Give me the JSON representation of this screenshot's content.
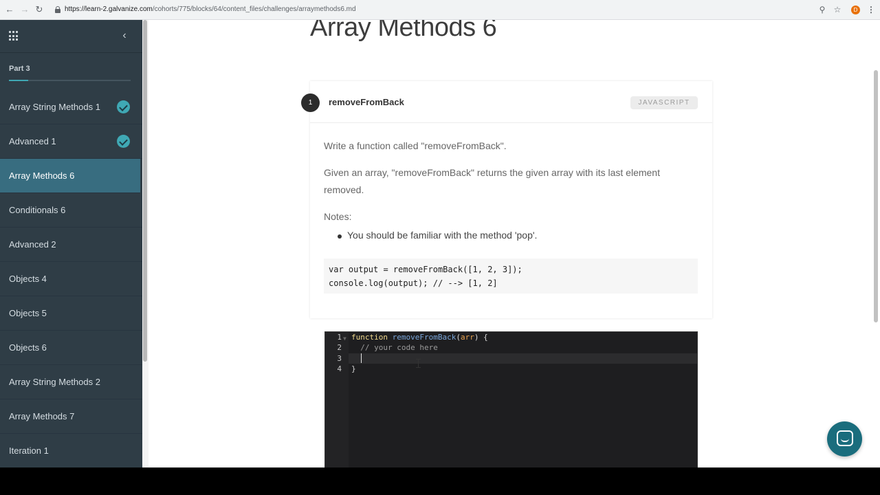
{
  "browser": {
    "url_host": "https://learn-2.galvanize.com",
    "url_path": "/cohorts/775/blocks/64/content_files/challenges/arraymethods6.md",
    "profile_initial": "D"
  },
  "sidebar": {
    "part_label": "Part 3",
    "part_progress": 0.16,
    "items": [
      {
        "label": "Array String Methods 1",
        "completed": true
      },
      {
        "label": "Advanced 1",
        "completed": true
      },
      {
        "label": "Array Methods 6",
        "active": true
      },
      {
        "label": "Conditionals 6"
      },
      {
        "label": "Advanced 2"
      },
      {
        "label": "Objects 4"
      },
      {
        "label": "Objects 5"
      },
      {
        "label": "Objects 6"
      },
      {
        "label": "Array String Methods 2"
      },
      {
        "label": "Array Methods 7"
      },
      {
        "label": "Iteration 1"
      }
    ]
  },
  "main": {
    "page_title": "Array Methods 6",
    "card": {
      "step_number": "1",
      "title": "removeFromBack",
      "language": "JAVASCRIPT",
      "paragraphs": [
        "Write a function called \"removeFromBack\".",
        "Given an array, \"removeFromBack\" returns the given array with its last element removed.",
        "Notes:"
      ],
      "bullet": "You should be familiar with the method 'pop'.",
      "code_sample": "var output = removeFromBack([1, 2, 3]);\nconsole.log(output); // --> [1, 2]"
    },
    "editor": {
      "line_numbers": [
        "1",
        "2",
        "3",
        "4"
      ],
      "lines": {
        "l1_keyword": "function",
        "l1_name": "removeFromBack",
        "l1_open": "(",
        "l1_param": "arr",
        "l1_close": ") {",
        "l2_comment": "  // your code here",
        "l3": "  ",
        "l4": "}"
      }
    }
  }
}
